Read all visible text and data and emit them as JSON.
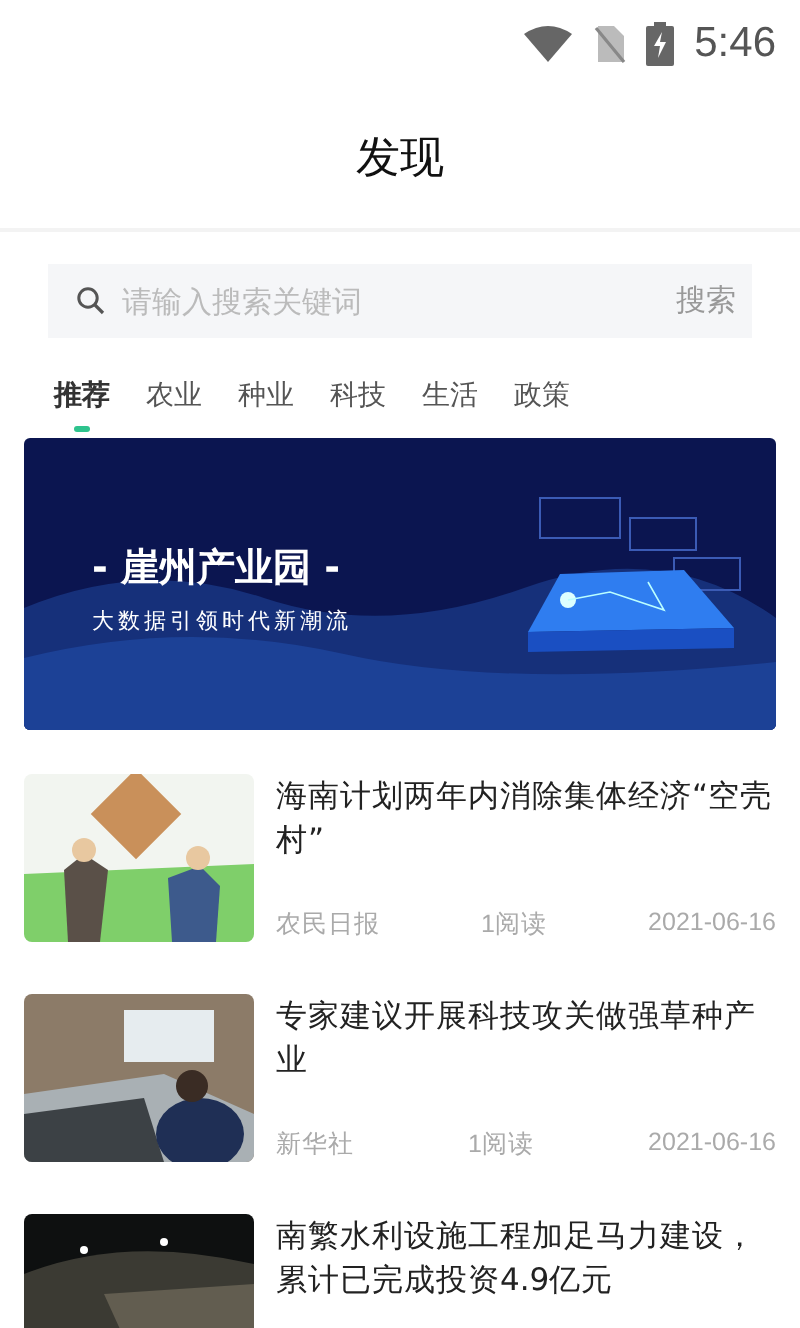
{
  "status_bar": {
    "time": "5:46"
  },
  "header": {
    "title": "发现"
  },
  "search": {
    "placeholder": "请输入搜索关键词",
    "button": "搜索"
  },
  "tabs": [
    {
      "label": "推荐",
      "selected": true
    },
    {
      "label": "农业",
      "selected": false
    },
    {
      "label": "种业",
      "selected": false
    },
    {
      "label": "科技",
      "selected": false
    },
    {
      "label": "生活",
      "selected": false
    },
    {
      "label": "政策",
      "selected": false
    }
  ],
  "banner": {
    "kind": "picture",
    "title": "- 崖州产业园 -",
    "subtitle": "大数据引领时代新潮流"
  },
  "news": [
    {
      "title": "海南计划两年内消除集体经济“空壳村”",
      "source": "农民日报",
      "reads": "1阅读",
      "date": "2021-06-16"
    },
    {
      "title": "专家建议开展科技攻关做强草种产业",
      "source": "新华社",
      "reads": "1阅读",
      "date": "2021-06-16"
    },
    {
      "title": "南繁水利设施工程加足马力建设，累计已完成投资4.9亿元"
    }
  ]
}
